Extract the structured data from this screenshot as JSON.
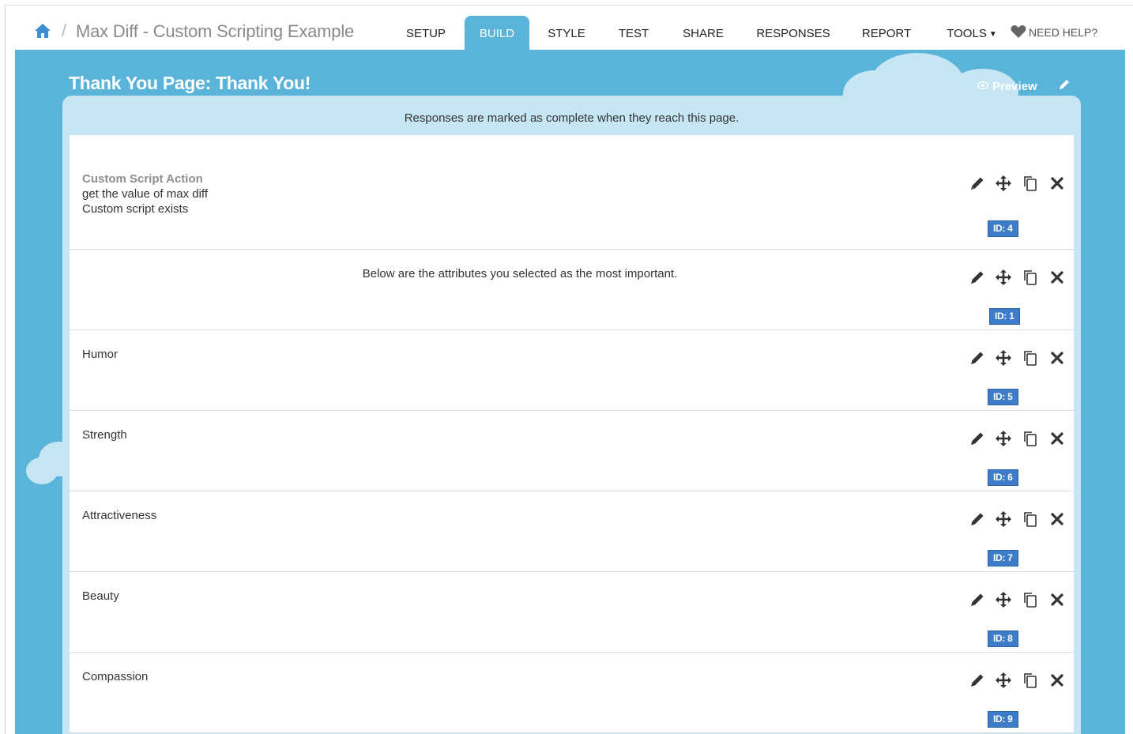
{
  "header": {
    "survey_title": "Max Diff - Custom Scripting Example",
    "separator": "/",
    "tabs": [
      {
        "label": "SETUP",
        "active": false
      },
      {
        "label": "BUILD",
        "active": true
      },
      {
        "label": "STYLE",
        "active": false
      },
      {
        "label": "TEST",
        "active": false
      },
      {
        "label": "SHARE",
        "active": false
      },
      {
        "label": "RESPONSES",
        "active": false
      },
      {
        "label": "REPORT",
        "active": false
      },
      {
        "label": "TOOLS",
        "active": false
      }
    ],
    "help_label": "NEED HELP?"
  },
  "page": {
    "title": "Thank You Page: Thank You!",
    "preview_label": "Preview",
    "completion_notice": "Responses are marked as complete when they reach this page."
  },
  "items": [
    {
      "type": "script",
      "title": "Custom Script Action",
      "line1": "get the value of max diff",
      "line2": "Custom script exists",
      "id_label": "ID: 4"
    },
    {
      "type": "text",
      "text": "Below are the attributes you selected as the most important.",
      "id_label": "ID: 1"
    },
    {
      "type": "text",
      "text": "Humor",
      "id_label": "ID: 5"
    },
    {
      "type": "text",
      "text": "Strength",
      "id_label": "ID: 6"
    },
    {
      "type": "text",
      "text": "Attractiveness",
      "id_label": "ID: 7"
    },
    {
      "type": "text",
      "text": "Beauty",
      "id_label": "ID: 8"
    },
    {
      "type": "text",
      "text": "Compassion",
      "id_label": "ID: 9"
    }
  ],
  "icons": {
    "home": "home-icon",
    "help": "heart-icon",
    "preview": "eye-icon",
    "edit": "pencil-icon",
    "move": "move-arrows-icon",
    "copy": "copy-icon",
    "delete": "close-icon"
  },
  "colors": {
    "accent": "#5ab3d8",
    "panel": "#c6e6f4",
    "badge": "#3d7cc9"
  }
}
